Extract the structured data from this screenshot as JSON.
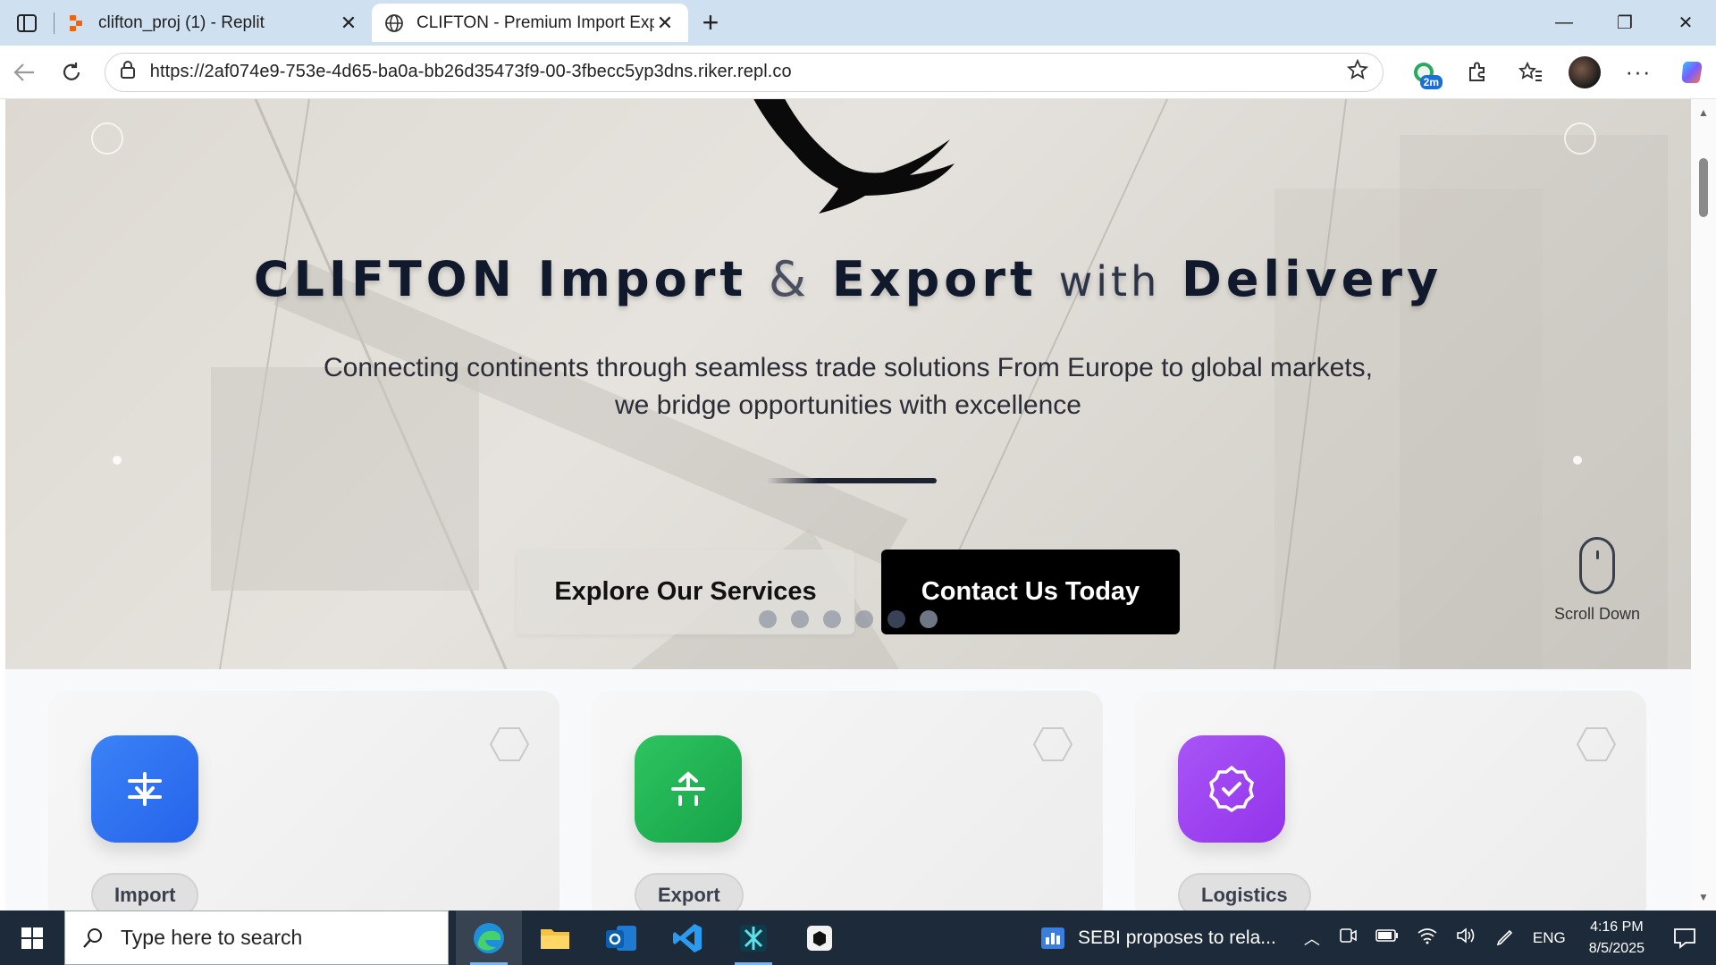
{
  "browser": {
    "tabs": [
      {
        "title": "clifton_proj (1) - Replit",
        "active": false
      },
      {
        "title": "CLIFTON - Premium Import Expor",
        "active": true
      }
    ],
    "url": "https://2af074e9-753e-4d65-ba0a-bb26d35473f9-00-3fbecc5yp3dns.riker.repl.co",
    "extension_badge": "2m"
  },
  "hero": {
    "title_brand": "CLIFTON",
    "title_import": "Import",
    "title_amp": "&",
    "title_export": "Export",
    "title_with": "with",
    "title_delivery": "Delivery",
    "subtitle_line1": "Connecting continents through seamless trade solutions From Europe to global markets,",
    "subtitle_line2": "we bridge opportunities with excellence",
    "explore_button": "Explore Our Services",
    "contact_button": "Contact Us Today",
    "carousel": {
      "count": 6,
      "active_index": 4
    },
    "scroll_hint": "Scroll Down"
  },
  "services": [
    {
      "label": "Import",
      "color": "#2f6ef2",
      "icon": "import-icon"
    },
    {
      "label": "Export",
      "color": "#22b14c",
      "icon": "export-icon"
    },
    {
      "label": "Logistics",
      "color": "#9b3df0",
      "icon": "badge-check-icon"
    }
  ],
  "taskbar": {
    "search_placeholder": "Type here to search",
    "news_text": "SEBI proposes to rela...",
    "language": "ENG",
    "time": "4:16 PM",
    "date": "8/5/2025"
  }
}
